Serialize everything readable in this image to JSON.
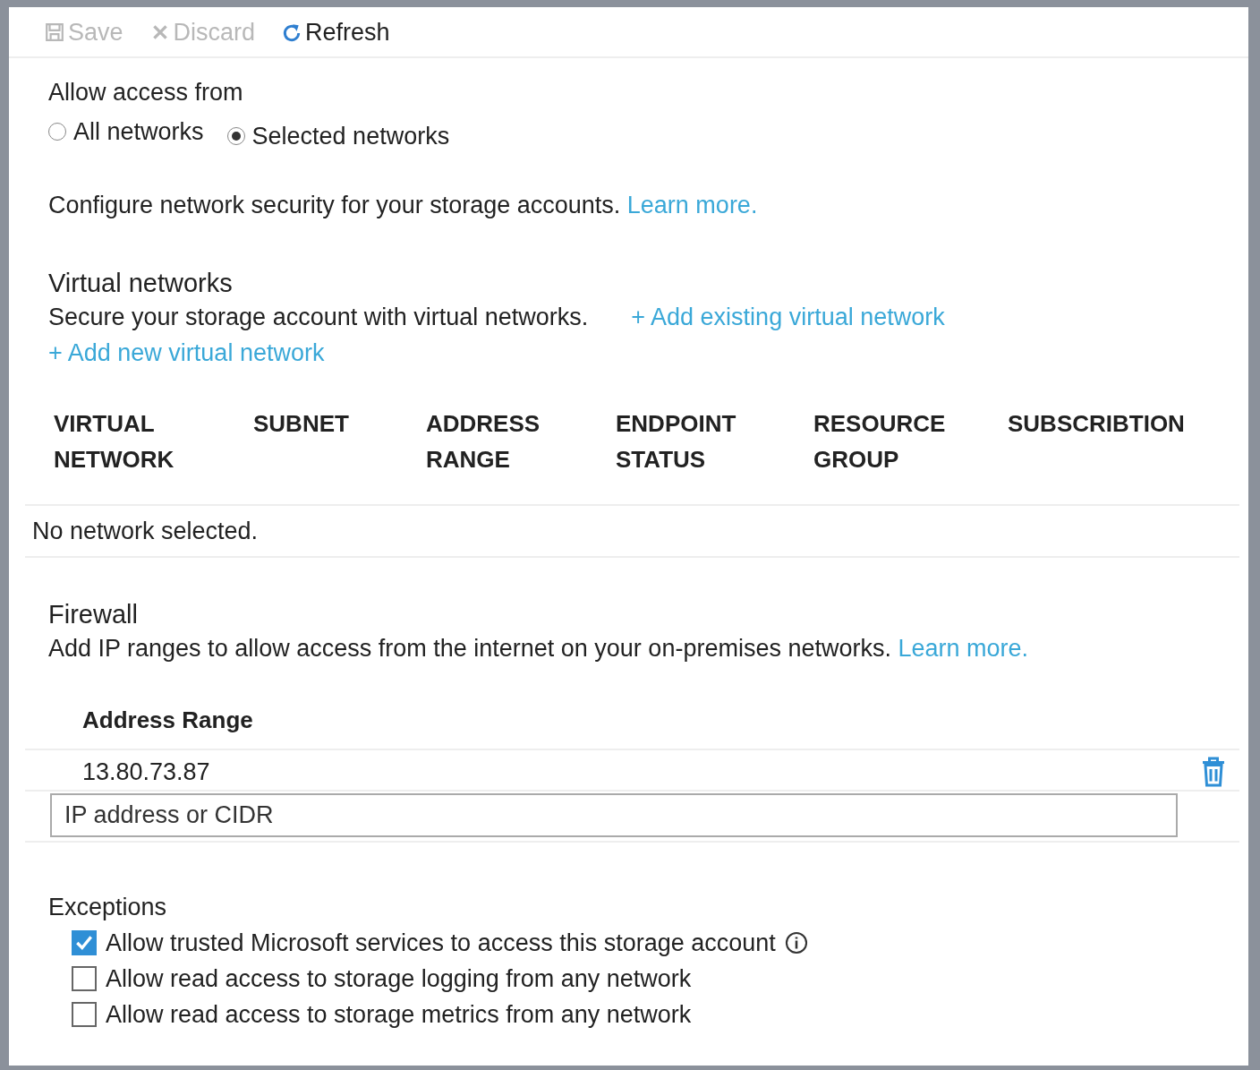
{
  "toolbar": [
    {
      "kind": "save",
      "label": "Save",
      "disabled": true
    },
    {
      "kind": "discard",
      "label": "Discard",
      "disabled": true
    },
    {
      "kind": "refresh",
      "label": "Refresh",
      "disabled": false
    }
  ],
  "access": {
    "label": "Allow access from",
    "options": [
      {
        "label": "All networks",
        "selected": false
      },
      {
        "label": "Selected networks",
        "selected": true
      }
    ]
  },
  "intro": {
    "text": "Configure network security for your storage accounts.",
    "link": "Learn more."
  },
  "virtual_networks": {
    "title": "Virtual networks",
    "description": "Secure your storage account with virtual networks.",
    "links": [
      "+ Add existing virtual network",
      "+ Add new virtual network"
    ],
    "columns": [
      "VIRTUAL NETWORK",
      "SUBNET",
      "ADDRESS RANGE",
      "ENDPOINT STATUS",
      "RESOURCE GROUP",
      "SUBSCRIBTION"
    ],
    "empty_text": "No network selected."
  },
  "firewall": {
    "title": "Firewall",
    "description": "Add IP ranges to allow access from the internet on your on-premises networks.",
    "link": "Learn more.",
    "column": "Address Range",
    "rows": [
      {
        "value": "13.80.73.87"
      }
    ],
    "input": {
      "placeholder": "IP address or CIDR"
    }
  },
  "exceptions": {
    "title": "Exceptions",
    "items": [
      {
        "label": "Allow trusted Microsoft services to access this storage account",
        "checked": true,
        "info": true
      },
      {
        "label": "Allow read access to storage logging from any network",
        "checked": false,
        "info": false
      },
      {
        "label": "Allow read access to storage metrics from any network",
        "checked": false,
        "info": false
      }
    ]
  }
}
